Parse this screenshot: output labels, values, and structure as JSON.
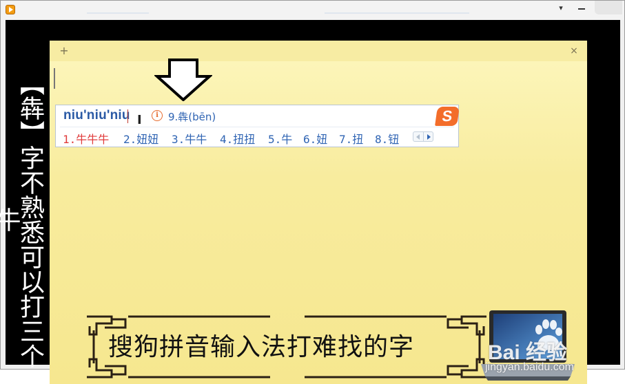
{
  "window": {
    "titlebar_dropdown_glyph": "▾",
    "close_glyph": "×",
    "add_glyph": "+"
  },
  "caption": {
    "vertical_text": "【犇】字不熟悉可以打三个牛"
  },
  "ime": {
    "input": "niu'niu'niu",
    "hint": "9.犇(bēn)",
    "info_icon": "info-icon",
    "logo_text": "S",
    "candidates": [
      "1.牛牛牛",
      "2.妞妞",
      "3.牛牛",
      "4.扭扭",
      "5.牛",
      "6.妞",
      "7.扭",
      "8.钮"
    ],
    "selected_index": 0
  },
  "banner": {
    "text": "搜狗拼音输入法打难找的字"
  },
  "watermark": {
    "logo": "Bai 经验",
    "url": "jingyan.baidu.com"
  },
  "colors": {
    "note_background": "#fcf5b9",
    "ime_text": "#2f64b3",
    "ime_selected": "#e03a3a",
    "sogou_orange": "#f36d2a"
  }
}
